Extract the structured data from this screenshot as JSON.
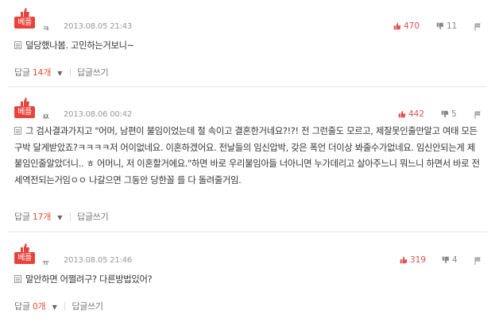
{
  "comments": [
    {
      "badge": "베플",
      "nickname": "ㅋ",
      "date": "2013.08.05 21:43",
      "likes": "470",
      "dislikes": "11",
      "text": "덜당했나봄. 고민하는거보니~",
      "reply_label": "답글",
      "reply_count": "14개",
      "write_reply": "답글쓰기"
    },
    {
      "badge": "베플",
      "nickname": "ㅉ",
      "date": "2013.08.06 00:42",
      "likes": "442",
      "dislikes": "5",
      "text": "그 검사결과가지고 \"어머, 남편이 불임이었는데 절 속이고 결혼한거네요?!?! 전 그런줄도 모르고, 제잘못인줄만알고 여태 모든 구박 달게받았죠?ㅋㅋㅋㅋ저 어이없네요. 이혼하겠어요. 전날들의 임신압박, 갖은 폭언 더이상 봐줄수가없네요. 임신안되는게 제 불임인줄알았더니.. ㅎ 어머니, 저 이혼할거에요.\"하면 바로 우리불임아들 너아니면 누가데리고 살아주느니 뭐느니 하면서 바로 전세역전되는거임ㅇㅇ 나갈으면 그동안 당한꼴 를 다 돌려줄거임.",
      "reply_label": "답글",
      "reply_count": "17개",
      "write_reply": "답글쓰기"
    },
    {
      "badge": "베플",
      "nickname": "ㅠ",
      "date": "2013.08.05 21:46",
      "likes": "319",
      "dislikes": "4",
      "text": "말안하면 어쩔려구? 다른방법있어?",
      "reply_label": "답글",
      "reply_count": "0개",
      "write_reply": "답글쓰기"
    }
  ],
  "colors": {
    "accent": "#e8423b",
    "like": "#e05050",
    "count": "#e0533b"
  },
  "icons": [
    "thumb-up-icon",
    "thumb-down-icon",
    "report-icon",
    "document-icon",
    "caret-down-icon"
  ]
}
